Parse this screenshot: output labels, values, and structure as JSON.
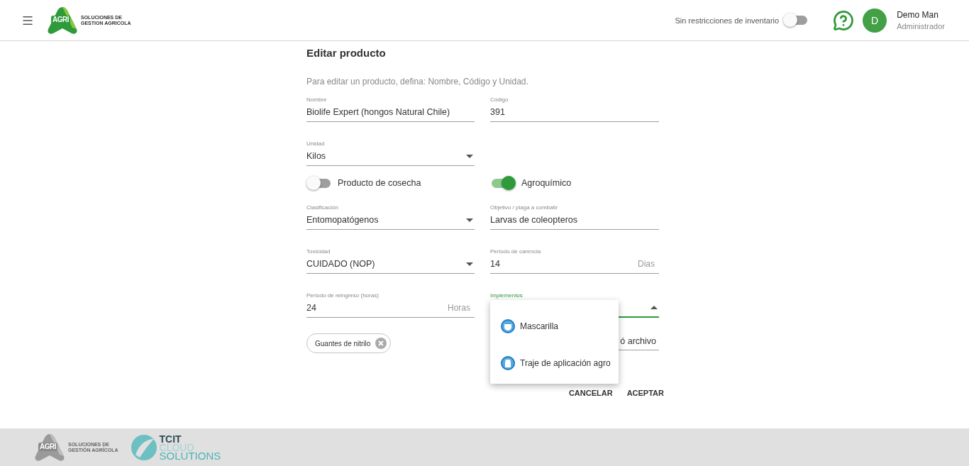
{
  "header": {
    "logo": {
      "mark": "AGRI",
      "lines": [
        "SOLUCIONES DE",
        "GESTION AGRICOLA"
      ]
    },
    "inventory_toggle": {
      "label": "Sin restricciones de inventario",
      "on": false
    },
    "user": {
      "initial": "D",
      "name": "Demo Man",
      "role": "Administrador"
    }
  },
  "form": {
    "title": "Editar producto",
    "hint": "Para editar un producto, defina: Nombre, Código y Unidad.",
    "rows": [
      {
        "cells": [
          {
            "kind": "text",
            "label": "Nombre",
            "value": "Biolife Expert (hongos Natural Chile)",
            "focused": false
          },
          {
            "kind": "text",
            "label": "Código",
            "value": "391",
            "focused": false
          }
        ]
      },
      {
        "cells": [
          {
            "kind": "select",
            "label": "Unidad",
            "value": "Kilos",
            "focused": false
          }
        ]
      },
      {
        "cells": [
          {
            "kind": "switch",
            "label": "Producto de cosecha",
            "on": false
          },
          {
            "kind": "switch",
            "label": "Agroquímico",
            "on": true
          }
        ]
      },
      {
        "cells": [
          {
            "kind": "select",
            "label": "Clasificación",
            "value": "Entomopatógenos",
            "focused": false
          },
          {
            "kind": "text",
            "label": "Objetivo / plaga a combatir",
            "value": "Larvas de coleopteros",
            "focused": false
          }
        ]
      },
      {
        "cells": [
          {
            "kind": "select",
            "label": "Toxicidad",
            "value": "CUIDADO (NOP)",
            "focused": false
          },
          {
            "kind": "text",
            "label": "Periodo de carencia",
            "value": "14",
            "suffix": "Dias",
            "focused": false
          }
        ]
      },
      {
        "cells": [
          {
            "kind": "text",
            "label": "Periodo de reingreso (horas)",
            "value": "24",
            "suffix": "Horas",
            "focused": false
          },
          {
            "kind": "select",
            "label": "Implementos",
            "focused": true,
            "menu": [
              "Mascarilla",
              "Traje de aplicación agro"
            ]
          }
        ]
      },
      {
        "cells": [
          {
            "kind": "chip",
            "label": "Guantes de nitrilo"
          },
          {
            "kind": "file",
            "value": "ó archivo"
          }
        ]
      }
    ],
    "buttons": [
      "CANCELAR",
      "ACEPTAR"
    ]
  },
  "footer": {
    "agri": {
      "mark": "AGRI",
      "lines": [
        "SOLUCIONES DE",
        "GESTIÓN AGRÍCOLA"
      ]
    },
    "tcit": [
      "TCIT",
      "CLOUD",
      "SOLUTIONS"
    ]
  }
}
